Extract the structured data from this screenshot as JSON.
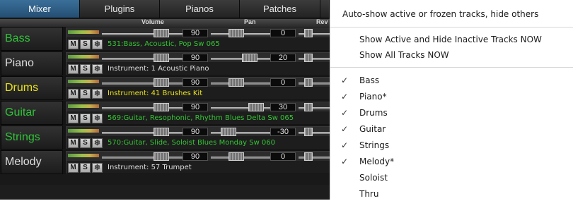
{
  "tabs": [
    {
      "label": "Mixer",
      "active": true
    },
    {
      "label": "Plugins",
      "active": false
    },
    {
      "label": "Pianos",
      "active": false
    },
    {
      "label": "Patches",
      "active": false
    }
  ],
  "column_headers": {
    "volume": "Volume",
    "pan": "Pan",
    "reverb": "Rev"
  },
  "buttons": {
    "mute": "M",
    "solo": "S",
    "freeze": "❄"
  },
  "tracks": [
    {
      "name": "Bass",
      "name_color": "#31c23a",
      "volume": "90",
      "pan": "0",
      "instrument": "531:Bass, Acoustic, Pop Sw 065",
      "instrument_color": "#34c534"
    },
    {
      "name": "Piano",
      "name_color": "#dedede",
      "volume": "90",
      "pan": "20",
      "instrument": "Instrument: 1 Acoustic Piano",
      "instrument_color": "#dedede"
    },
    {
      "name": "Drums",
      "name_color": "#e9e21a",
      "volume": "90",
      "pan": "0",
      "instrument": "Instrument: 41 Brushes Kit",
      "instrument_color": "#e9e21a"
    },
    {
      "name": "Guitar",
      "name_color": "#31c23a",
      "volume": "90",
      "pan": "30",
      "instrument": "569:Guitar, Resophonic, Rhythm Blues Delta Sw 065",
      "instrument_color": "#34c534"
    },
    {
      "name": "Strings",
      "name_color": "#31c23a",
      "volume": "90",
      "pan": "-30",
      "instrument": "570:Guitar, Slide, Soloist Blues Monday Sw 060",
      "instrument_color": "#34c534"
    },
    {
      "name": "Melody",
      "name_color": "#dedede",
      "volume": "90",
      "pan": "0",
      "instrument": "Instrument: 57 Trumpet",
      "instrument_color": "#dedede"
    }
  ],
  "menu": {
    "auto_show": "Auto-show active or frozen tracks, hide others",
    "show_active_hide_inactive": "Show Active and Hide Inactive Tracks NOW",
    "show_all": "Show All Tracks NOW",
    "track_items": [
      {
        "label": "Bass",
        "checked": true
      },
      {
        "label": "Piano*",
        "checked": true
      },
      {
        "label": "Drums",
        "checked": true
      },
      {
        "label": "Guitar",
        "checked": true
      },
      {
        "label": "Strings",
        "checked": true
      },
      {
        "label": "Melody*",
        "checked": true
      },
      {
        "label": "Soloist",
        "checked": false
      },
      {
        "label": "Thru",
        "checked": false
      }
    ],
    "check_glyph": "✓"
  },
  "colors": {
    "active_tab": "#2f5f87",
    "green_track": "#31c23a",
    "yellow_track": "#e9e21a"
  }
}
